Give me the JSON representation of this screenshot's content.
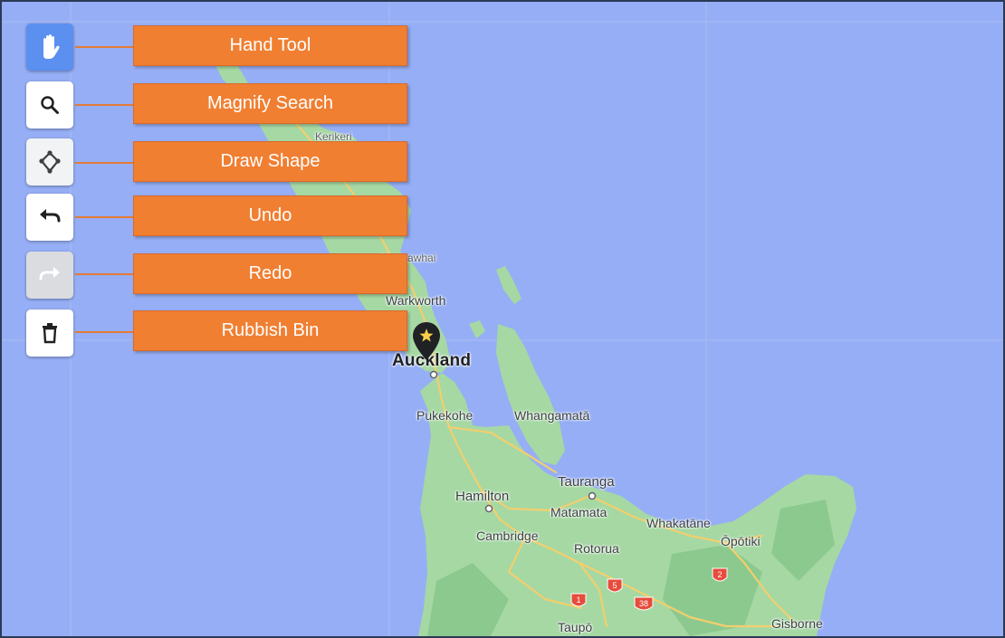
{
  "toolbar": {
    "tools": [
      {
        "id": "hand",
        "icon": "hand-icon",
        "label": "Hand Tool",
        "state": "active"
      },
      {
        "id": "magnify",
        "icon": "magnify-icon",
        "label": "Magnify Search",
        "state": "normal"
      },
      {
        "id": "draw",
        "icon": "draw-shape-icon",
        "label": "Draw Shape",
        "state": "normal"
      },
      {
        "id": "undo",
        "icon": "undo-icon",
        "label": "Undo",
        "state": "normal"
      },
      {
        "id": "redo",
        "icon": "redo-icon",
        "label": "Redo",
        "state": "disabled"
      },
      {
        "id": "bin",
        "icon": "trash-icon",
        "label": "Rubbish Bin",
        "state": "normal"
      }
    ]
  },
  "map": {
    "places": {
      "kerikeri": "Kerikeri",
      "mangawhai": "Mangawhai",
      "warkworth": "Warkworth",
      "auckland": "Auckland",
      "pukekohe": "Pukekohe",
      "whangamata": "Whangamatā",
      "tauranga": "Tauranga",
      "hamilton": "Hamilton",
      "matamata": "Matamata",
      "whakatane": "Whakatāne",
      "cambridge": "Cambridge",
      "rotorua": "Rotorua",
      "opotiki": "Ōpōtiki",
      "taupo": "Taupō",
      "gisborne": "Gisborne"
    },
    "shields": [
      "1",
      "5",
      "38",
      "2"
    ],
    "colors": {
      "ocean": "#96aef5",
      "land": "#9dd3a2",
      "road": "#f4d37a",
      "marker": "#202124"
    }
  }
}
